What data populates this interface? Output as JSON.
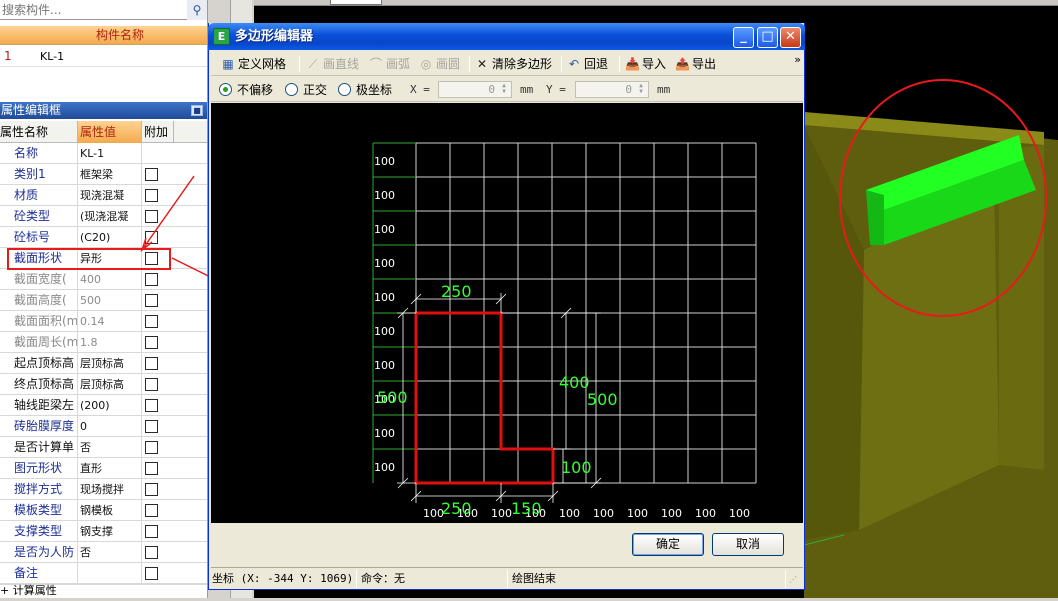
{
  "search": {
    "placeholder": "搜索构件..."
  },
  "component_list": {
    "header": "构件名称",
    "rows": [
      {
        "index": "1",
        "name": "KL-1"
      }
    ]
  },
  "property_editor": {
    "title": "属性编辑框",
    "pin": "📌",
    "columns": {
      "name": "属性名称",
      "value": "属性值",
      "extra": "附加"
    },
    "rows": [
      {
        "name": "名称",
        "value": "KL-1",
        "style": "blue",
        "has_checkbox": false
      },
      {
        "name": "类别1",
        "value": "框架梁",
        "style": "blue",
        "has_checkbox": true
      },
      {
        "name": "材质",
        "value": "现浇混凝",
        "style": "blue",
        "has_checkbox": true
      },
      {
        "name": "砼类型",
        "value": "(现浇混凝",
        "style": "blue",
        "has_checkbox": true
      },
      {
        "name": "砼标号",
        "value": "(C20)",
        "style": "blue",
        "has_checkbox": true
      },
      {
        "name": "截面形状",
        "value": "异形",
        "style": "blue",
        "has_checkbox": true
      },
      {
        "name": "截面宽度(",
        "value": "400",
        "style": "gray",
        "has_checkbox": true
      },
      {
        "name": "截面高度(",
        "value": "500",
        "style": "gray",
        "has_checkbox": true
      },
      {
        "name": "截面面积(m",
        "value": "0.14",
        "style": "gray",
        "has_checkbox": true
      },
      {
        "name": "截面周长(m",
        "value": "1.8",
        "style": "gray",
        "has_checkbox": true
      },
      {
        "name": "起点顶标高",
        "value": "层顶标高",
        "style": "black",
        "has_checkbox": true
      },
      {
        "name": "终点顶标高",
        "value": "层顶标高",
        "style": "black",
        "has_checkbox": true
      },
      {
        "name": "轴线距梁左",
        "value": "(200)",
        "style": "black",
        "has_checkbox": true
      },
      {
        "name": "砖胎膜厚度",
        "value": "0",
        "style": "blue",
        "has_checkbox": true
      },
      {
        "name": "是否计算单",
        "value": "否",
        "style": "black",
        "has_checkbox": true
      },
      {
        "name": "图元形状",
        "value": "直形",
        "style": "blue",
        "has_checkbox": true
      },
      {
        "name": "搅拌方式",
        "value": "现场搅拌",
        "style": "blue",
        "has_checkbox": true
      },
      {
        "name": "模板类型",
        "value": "钢模板",
        "style": "blue",
        "has_checkbox": true
      },
      {
        "name": "支撑类型",
        "value": "钢支撑",
        "style": "blue",
        "has_checkbox": true
      },
      {
        "name": "是否为人防",
        "value": "否",
        "style": "blue",
        "has_checkbox": true
      },
      {
        "name": "备注",
        "value": "",
        "style": "blue",
        "has_checkbox": true
      }
    ],
    "tree_row": "+ 计算属性"
  },
  "dialog": {
    "title": "多边形编辑器",
    "title_icon": "E",
    "min": "_",
    "max": "□",
    "close": "✕",
    "toolbar": {
      "define_grid": "定义网格",
      "draw_line": "画直线",
      "draw_arc": "画弧",
      "draw_circle": "画圆",
      "clear_polygon": "清除多边形",
      "undo": "回退",
      "import": "导入",
      "export": "导出",
      "more": "»"
    },
    "options": {
      "no_offset": "不偏移",
      "orthogonal": "正交",
      "polar": "极坐标",
      "x_label": "X =",
      "x_value": "0",
      "x_unit": "mm",
      "y_label": "Y =",
      "y_value": "0",
      "y_unit": "mm"
    },
    "grid": {
      "row_labels": [
        "100",
        "100",
        "100",
        "100",
        "100",
        "100",
        "100",
        "100",
        "100",
        "100"
      ],
      "col_labels": [
        "100",
        "100",
        "100",
        "100",
        "100",
        "100",
        "100",
        "100",
        "100",
        "100"
      ]
    },
    "dimensions": {
      "top": "250",
      "left_total": "500",
      "right_upper": "400",
      "right_total": "500",
      "right_lower": "100",
      "bottom_left": "250",
      "bottom_right": "150"
    },
    "ok": "确定",
    "cancel": "取消",
    "status": {
      "coords": "坐标 (X: -344 Y: 1069)",
      "command": "命令：无",
      "message": "绘图结束"
    }
  },
  "colors": {
    "annotation_red": "#e81a1a",
    "shape_red": "#e01010",
    "dimension_green": "#33ff33",
    "beam_olive": "#7a7a12",
    "beam_highlight": "#22ff22"
  }
}
